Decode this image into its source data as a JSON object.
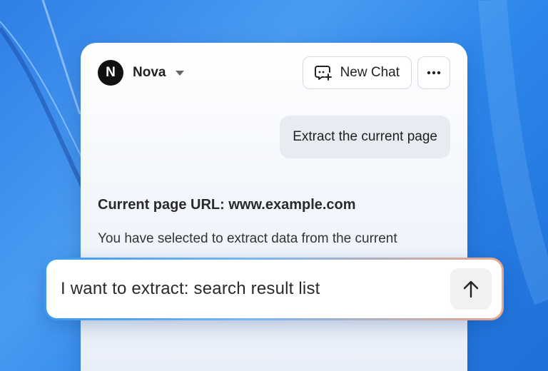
{
  "agent": {
    "avatar_letter": "N",
    "name": "Nova"
  },
  "header": {
    "new_chat_label": "New Chat"
  },
  "conversation": {
    "user_message": "Extract the current page",
    "reply_title": "Current page URL: www.example.com",
    "reply_body": "You have selected to extract data from the current"
  },
  "input": {
    "value": "I want to extract: search result list"
  },
  "icons": {
    "new_chat": "chat-plus-icon",
    "more": "more-horizontal-icon",
    "send": "arrow-up-icon",
    "agent_menu": "caret-down-icon"
  },
  "colors": {
    "background": "#2f7fe6",
    "avatar": "#111111",
    "user_bubble": "#e7ebf2",
    "input_border_start": "#3a9af0",
    "input_border_end": "#e9a78a"
  }
}
